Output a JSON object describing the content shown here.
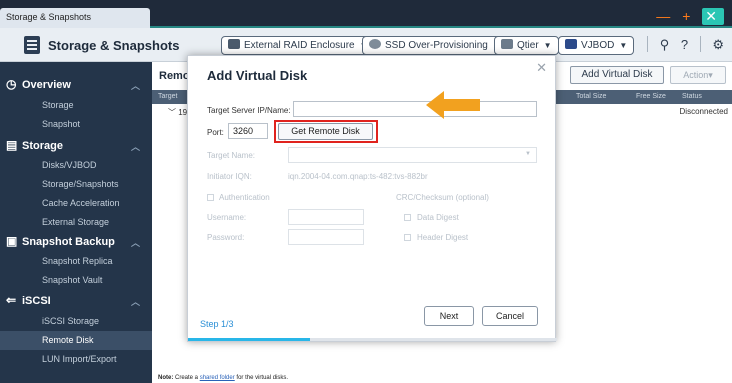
{
  "window": {
    "tab_title": "Storage & Snapshots",
    "controls": [
      "—",
      "+",
      "✕"
    ]
  },
  "header": {
    "app_title": "Storage & Snapshots",
    "buttons": [
      {
        "label": "External RAID Enclosure",
        "icon": "raid-enclosure-icon"
      },
      {
        "label": "SSD Over-Provisioning",
        "icon": "ssd-icon"
      },
      {
        "label": "Qtier",
        "icon": "qtier-icon"
      },
      {
        "label": "VJBOD",
        "icon": "vjbod-icon"
      }
    ],
    "icons": [
      "search-icon",
      "help-icon",
      "gear-icon"
    ]
  },
  "sidebar": {
    "groups": [
      {
        "label": "Overview",
        "icon": "overview-icon",
        "items": [
          "Storage",
          "Snapshot"
        ]
      },
      {
        "label": "Storage",
        "icon": "storage-icon",
        "items": [
          "Disks/VJBOD",
          "Storage/Snapshots",
          "Cache Acceleration",
          "External Storage"
        ]
      },
      {
        "label": "Snapshot Backup",
        "icon": "snapshot-backup-icon",
        "items": [
          "Snapshot Replica",
          "Snapshot Vault"
        ]
      },
      {
        "label": "iSCSI",
        "icon": "iscsi-icon",
        "items": [
          "iSCSI Storage",
          "Remote Disk",
          "LUN Import/Export"
        ]
      }
    ],
    "active_item": "Remote Disk"
  },
  "main": {
    "section_label": "Remo",
    "add_button": "Add Virtual Disk",
    "action_button": "Action",
    "columns": {
      "target": "Target",
      "total_size": "Total Size",
      "free_size": "Free Size",
      "status": "Status"
    },
    "row": {
      "prefix": "19",
      "status": "Disconnected"
    },
    "note": {
      "bold": "Note:",
      "pre": " Create a ",
      "link": "shared folder",
      "post": " for the virtual disks."
    }
  },
  "dialog": {
    "title": "Add Virtual Disk",
    "target_server_label": "Target Server IP/Name:",
    "target_server_value": "",
    "port_label": "Port:",
    "port_value": "3260",
    "get_remote_disk": "Get Remote Disk",
    "target_name_label": "Target Name:",
    "initiator_label": "Initiator IQN:",
    "initiator_value": "iqn.2004-04.com.qnap:ts-482:tvs-882br",
    "authentication_label": "Authentication",
    "crc_label": "CRC/Checksum (optional)",
    "username_label": "Username:",
    "password_label": "Password:",
    "data_digest_label": "Data Digest",
    "header_digest_label": "Header Digest",
    "step": "Step 1/3",
    "next": "Next",
    "cancel": "Cancel",
    "progress": 0.33,
    "accent_color": "#28b6e8",
    "highlight_color": "#e0231e",
    "arrow_color": "#f2a11f"
  }
}
